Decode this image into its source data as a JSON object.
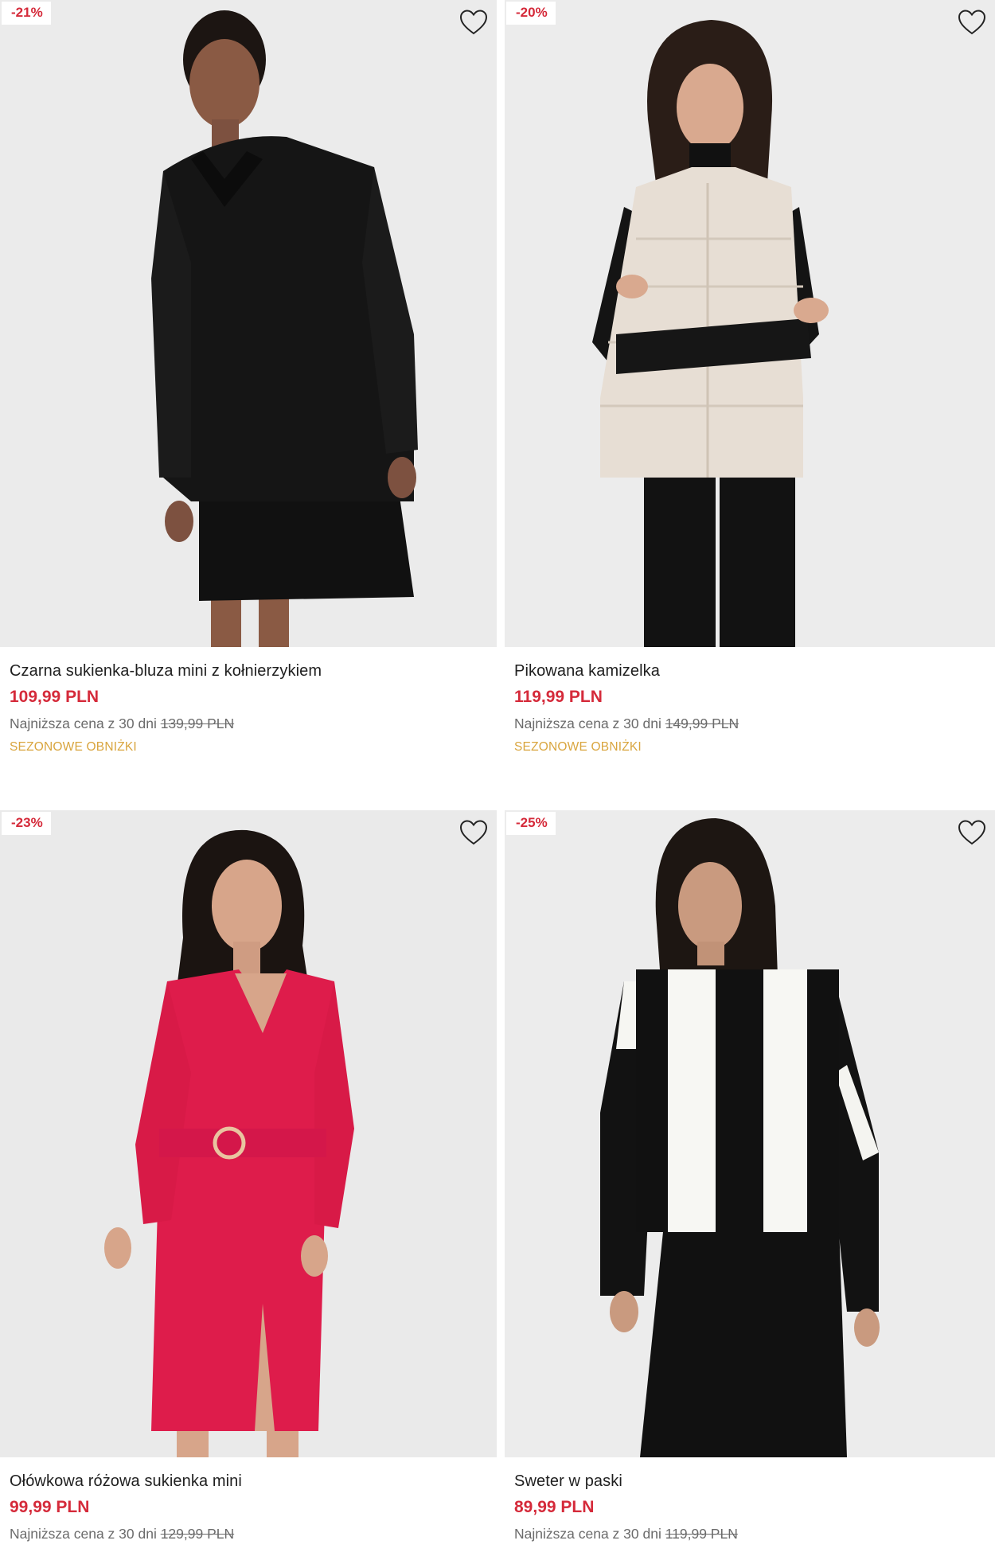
{
  "products": [
    {
      "badge": "-21%",
      "name": "Czarna sukienka-bluza mini z kołnierzykiem",
      "price": "109,99 PLN",
      "lowest_label": "Najniższa cena z 30 dni",
      "lowest_price": "139,99 PLN",
      "tag": "SEZONOWE OBNIŻKI"
    },
    {
      "badge": "-20%",
      "name": "Pikowana kamizelka",
      "price": "119,99 PLN",
      "lowest_label": "Najniższa cena z 30 dni",
      "lowest_price": "149,99 PLN",
      "tag": "SEZONOWE OBNIŻKI"
    },
    {
      "badge": "-23%",
      "name": "Ołówkowa różowa sukienka mini",
      "price": "99,99 PLN",
      "lowest_label": "Najniższa cena z 30 dni",
      "lowest_price": "129,99 PLN"
    },
    {
      "badge": "-25%",
      "name": "Sweter w paski",
      "price": "89,99 PLN",
      "lowest_label": "Najniższa cena z 30 dni",
      "lowest_price": "119,99 PLN"
    }
  ],
  "icons": {
    "favorite": "heart-outline-icon"
  },
  "colors": {
    "sale_red": "#d52a3a",
    "tag_gold": "#d9a53e",
    "muted_text": "#6b6b6b"
  }
}
